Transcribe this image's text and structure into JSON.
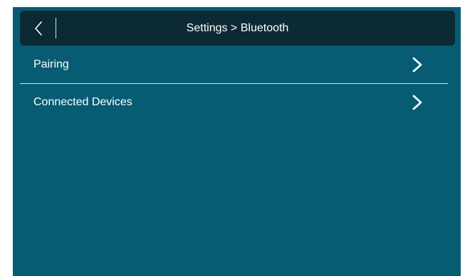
{
  "header": {
    "title": "Settings > Bluetooth",
    "back_icon": "chevron-left-icon"
  },
  "list": {
    "items": [
      {
        "label": "Pairing",
        "icon": "chevron-right-icon"
      },
      {
        "label": "Connected Devices",
        "icon": "chevron-right-icon"
      }
    ]
  },
  "colors": {
    "background": "#075c73",
    "header_bar": "#0b2a34",
    "text": "#ffffff",
    "divider": "#cfdde2"
  }
}
